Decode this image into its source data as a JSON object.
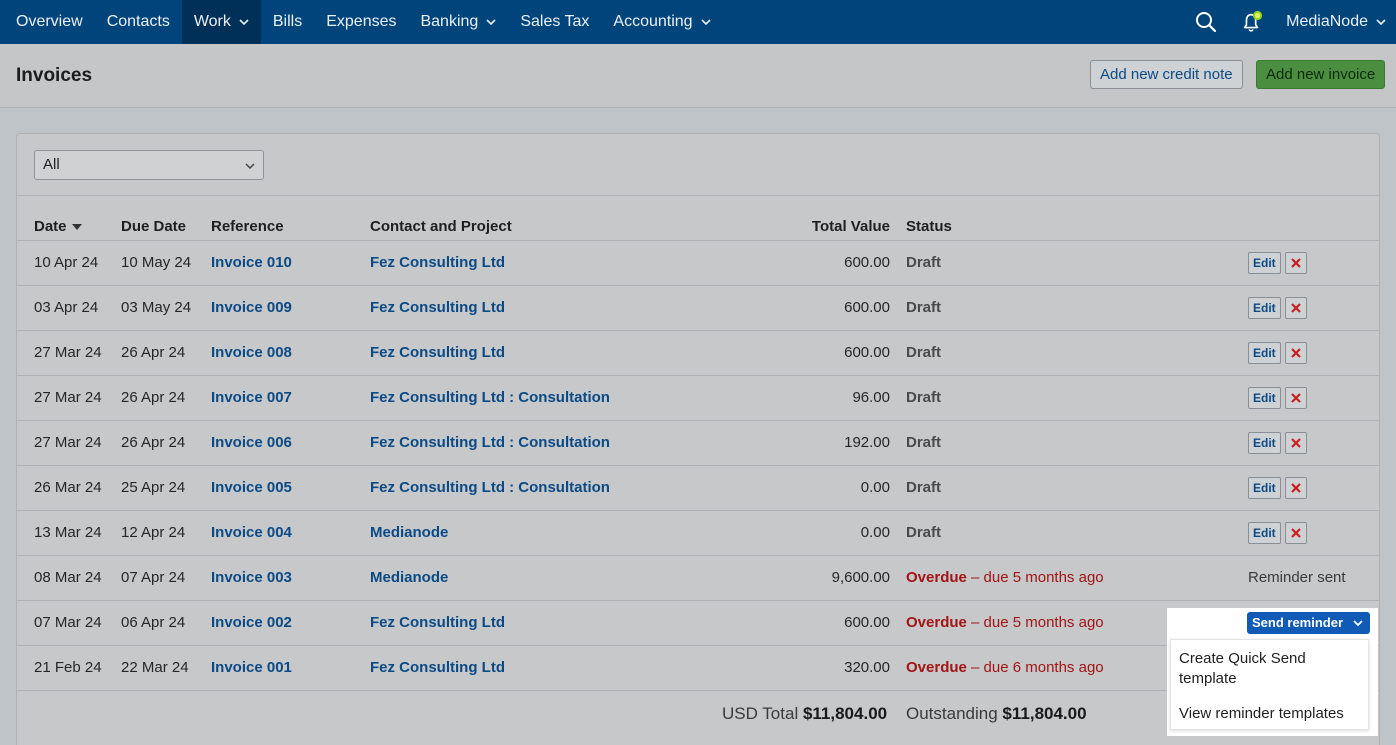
{
  "nav": {
    "items": [
      {
        "label": "Overview",
        "dropdown": false,
        "active": false
      },
      {
        "label": "Contacts",
        "dropdown": false,
        "active": false
      },
      {
        "label": "Work",
        "dropdown": true,
        "active": true
      },
      {
        "label": "Bills",
        "dropdown": false,
        "active": false
      },
      {
        "label": "Expenses",
        "dropdown": false,
        "active": false
      },
      {
        "label": "Banking",
        "dropdown": true,
        "active": false
      },
      {
        "label": "Sales Tax",
        "dropdown": false,
        "active": false
      },
      {
        "label": "Accounting",
        "dropdown": true,
        "active": false
      }
    ],
    "account_label": "MediaNode",
    "icons": [
      "search-icon",
      "notification-bell-icon"
    ]
  },
  "header": {
    "title": "Invoices",
    "credit_note_button": "Add new credit note",
    "new_invoice_button": "Add new invoice"
  },
  "filter": {
    "selected": "All"
  },
  "table": {
    "columns": [
      "Date",
      "Due Date",
      "Reference",
      "Contact and Project",
      "Total Value",
      "Status"
    ],
    "sort_column": "Date",
    "rows": [
      {
        "date": "10 Apr 24",
        "due": "10 May 24",
        "ref": "Invoice 010",
        "contact": "Fez Consulting Ltd",
        "total": "600.00",
        "status": "Draft",
        "status_detail": "",
        "action": "edit"
      },
      {
        "date": "03 Apr 24",
        "due": "03 May 24",
        "ref": "Invoice 009",
        "contact": "Fez Consulting Ltd",
        "total": "600.00",
        "status": "Draft",
        "status_detail": "",
        "action": "edit"
      },
      {
        "date": "27 Mar 24",
        "due": "26 Apr 24",
        "ref": "Invoice 008",
        "contact": "Fez Consulting Ltd",
        "total": "600.00",
        "status": "Draft",
        "status_detail": "",
        "action": "edit"
      },
      {
        "date": "27 Mar 24",
        "due": "26 Apr 24",
        "ref": "Invoice 007",
        "contact": "Fez Consulting Ltd : Consultation",
        "total": "96.00",
        "status": "Draft",
        "status_detail": "",
        "action": "edit"
      },
      {
        "date": "27 Mar 24",
        "due": "26 Apr 24",
        "ref": "Invoice 006",
        "contact": "Fez Consulting Ltd : Consultation",
        "total": "192.00",
        "status": "Draft",
        "status_detail": "",
        "action": "edit"
      },
      {
        "date": "26 Mar 24",
        "due": "25 Apr 24",
        "ref": "Invoice 005",
        "contact": "Fez Consulting Ltd : Consultation",
        "total": "0.00",
        "status": "Draft",
        "status_detail": "",
        "action": "edit"
      },
      {
        "date": "13 Mar 24",
        "due": "12 Apr 24",
        "ref": "Invoice 004",
        "contact": "Medianode",
        "total": "0.00",
        "status": "Draft",
        "status_detail": "",
        "action": "edit"
      },
      {
        "date": "08 Mar 24",
        "due": "07 Apr 24",
        "ref": "Invoice 003",
        "contact": "Medianode",
        "total": "9,600.00",
        "status": "Overdue",
        "status_detail": " – due 5 months ago",
        "action": "reminder-sent"
      },
      {
        "date": "07 Mar 24",
        "due": "06 Apr 24",
        "ref": "Invoice 002",
        "contact": "Fez Consulting Ltd",
        "total": "600.00",
        "status": "Overdue",
        "status_detail": " – due 5 months ago",
        "action": "send-reminder"
      },
      {
        "date": "21 Feb 24",
        "due": "22 Mar 24",
        "ref": "Invoice 001",
        "contact": "Fez Consulting Ltd",
        "total": "320.00",
        "status": "Overdue",
        "status_detail": " – due 6 months ago",
        "action": "none"
      }
    ],
    "edit_label": "Edit",
    "reminder_sent_label": "Reminder sent"
  },
  "totals": {
    "usd_label": "USD Total",
    "usd_value": "$11,804.00",
    "outstanding_label": "Outstanding",
    "outstanding_value": "$11,804.00"
  },
  "reminder_dropdown": {
    "button_label": "Send reminder",
    "items": [
      "Create Quick Send template",
      "View reminder templates"
    ]
  },
  "colors": {
    "nav_bg": "#00447c",
    "link": "#0b4a85",
    "overdue": "#a31515",
    "primary_button": "#4b8e3f",
    "send_button": "#0f5bb5"
  }
}
